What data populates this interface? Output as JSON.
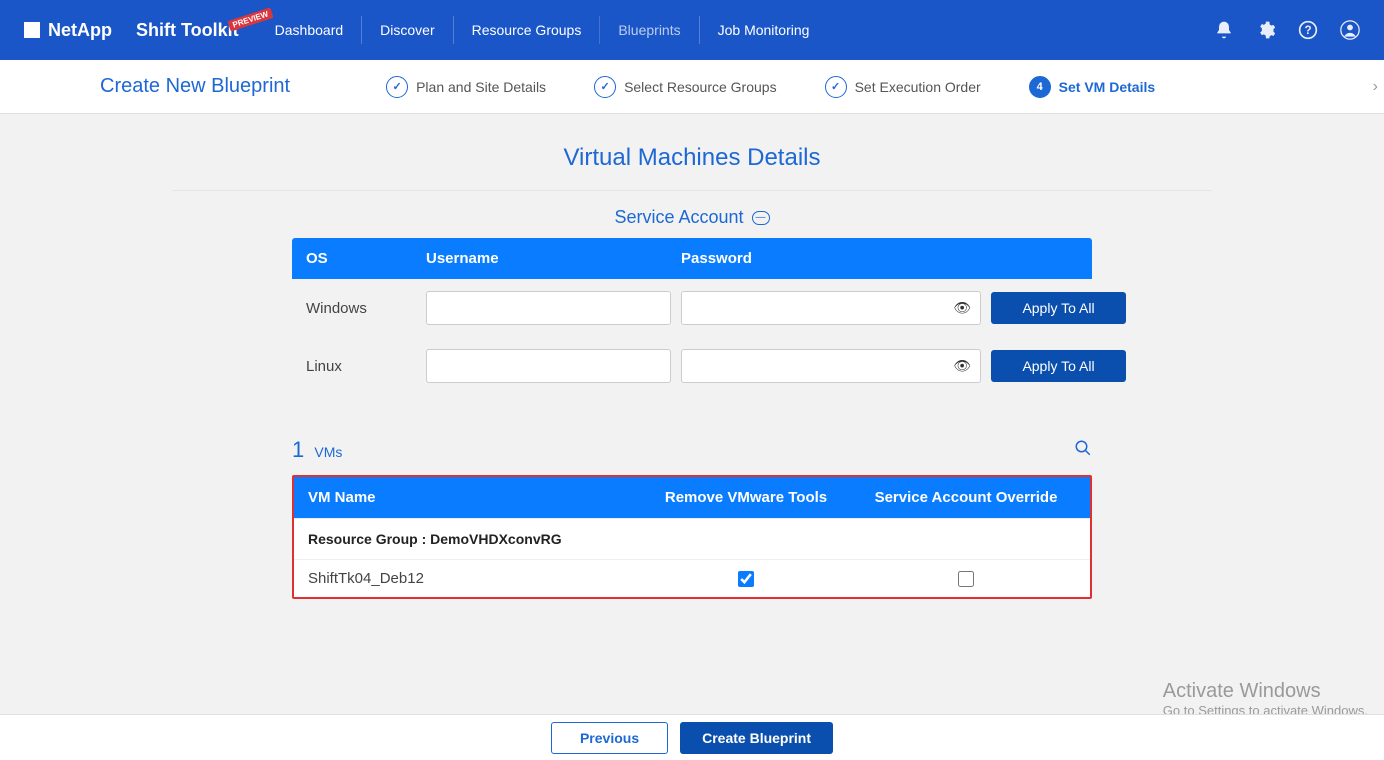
{
  "header": {
    "brand": "NetApp",
    "product": "Shift Toolkit",
    "badge": "PREVIEW",
    "nav": [
      "Dashboard",
      "Discover",
      "Resource Groups",
      "Blueprints",
      "Job Monitoring"
    ],
    "active_nav": 3
  },
  "wizard": {
    "title": "Create New Blueprint",
    "steps": [
      {
        "label": "Plan and Site Details",
        "state": "done"
      },
      {
        "label": "Select Resource Groups",
        "state": "done"
      },
      {
        "label": "Set Execution Order",
        "state": "done"
      },
      {
        "label": "Set VM Details",
        "state": "active",
        "num": "4"
      }
    ]
  },
  "main": {
    "title": "Virtual Machines Details",
    "section": "Service Account",
    "sa_headers": {
      "os": "OS",
      "user": "Username",
      "pw": "Password"
    },
    "sa_rows": [
      {
        "os": "Windows",
        "user": "",
        "pw": "",
        "btn": "Apply To All"
      },
      {
        "os": "Linux",
        "user": "",
        "pw": "",
        "btn": "Apply To All"
      }
    ],
    "vm_count": "1",
    "vm_count_label": "VMs",
    "vm_headers": {
      "name": "VM Name",
      "remove": "Remove VMware Tools",
      "override": "Service Account Override"
    },
    "vm_group_label": "Resource Group : DemoVHDXconvRG",
    "vm_rows": [
      {
        "name": "ShiftTk04_Deb12",
        "remove": true,
        "override": false
      }
    ]
  },
  "footer": {
    "prev": "Previous",
    "create": "Create Blueprint"
  },
  "watermark": {
    "l1": "Activate Windows",
    "l2": "Go to Settings to activate Windows."
  }
}
